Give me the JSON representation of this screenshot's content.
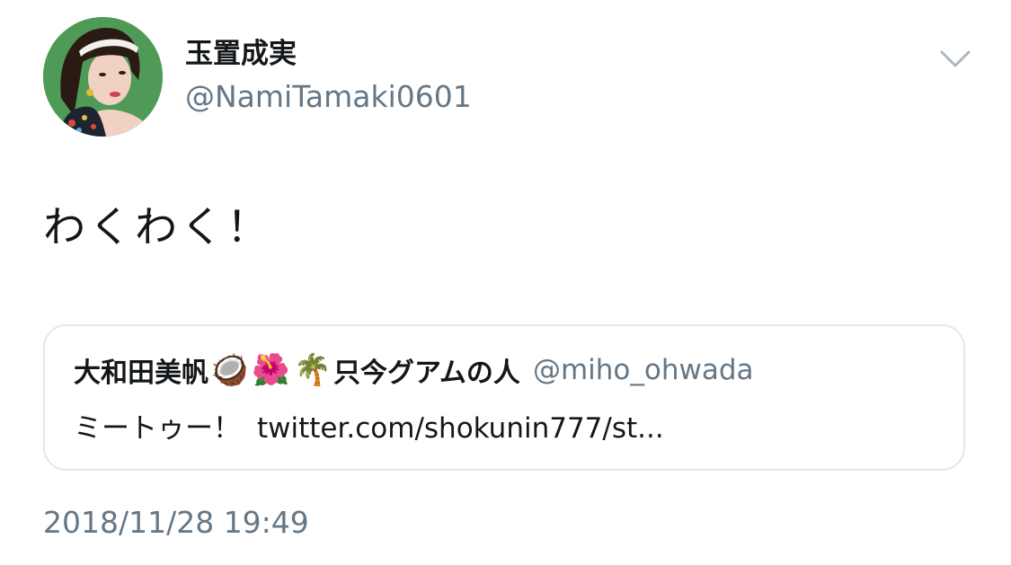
{
  "author": {
    "display_name": "玉置成実",
    "handle": "@NamiTamaki0601",
    "avatar_icon": "profile-photo",
    "avatar_bg_color": "#4f9a56"
  },
  "tweet": {
    "text": "わくわく！",
    "timestamp": "2018/11/28 19:49"
  },
  "quoted_tweet": {
    "display_name": "大和田美帆",
    "emojis": [
      "🥥",
      "🌺",
      "🌴"
    ],
    "name_suffix": "只今グアムの人",
    "handle": "@miho_ohwada",
    "text": "ミートゥー！",
    "link_text": "twitter.com/shokunin777/st..."
  },
  "menu": {
    "icon": "chevron-down-icon"
  },
  "colors": {
    "text": "#14171a",
    "secondary": "#657786",
    "border": "#e1e8ed"
  }
}
